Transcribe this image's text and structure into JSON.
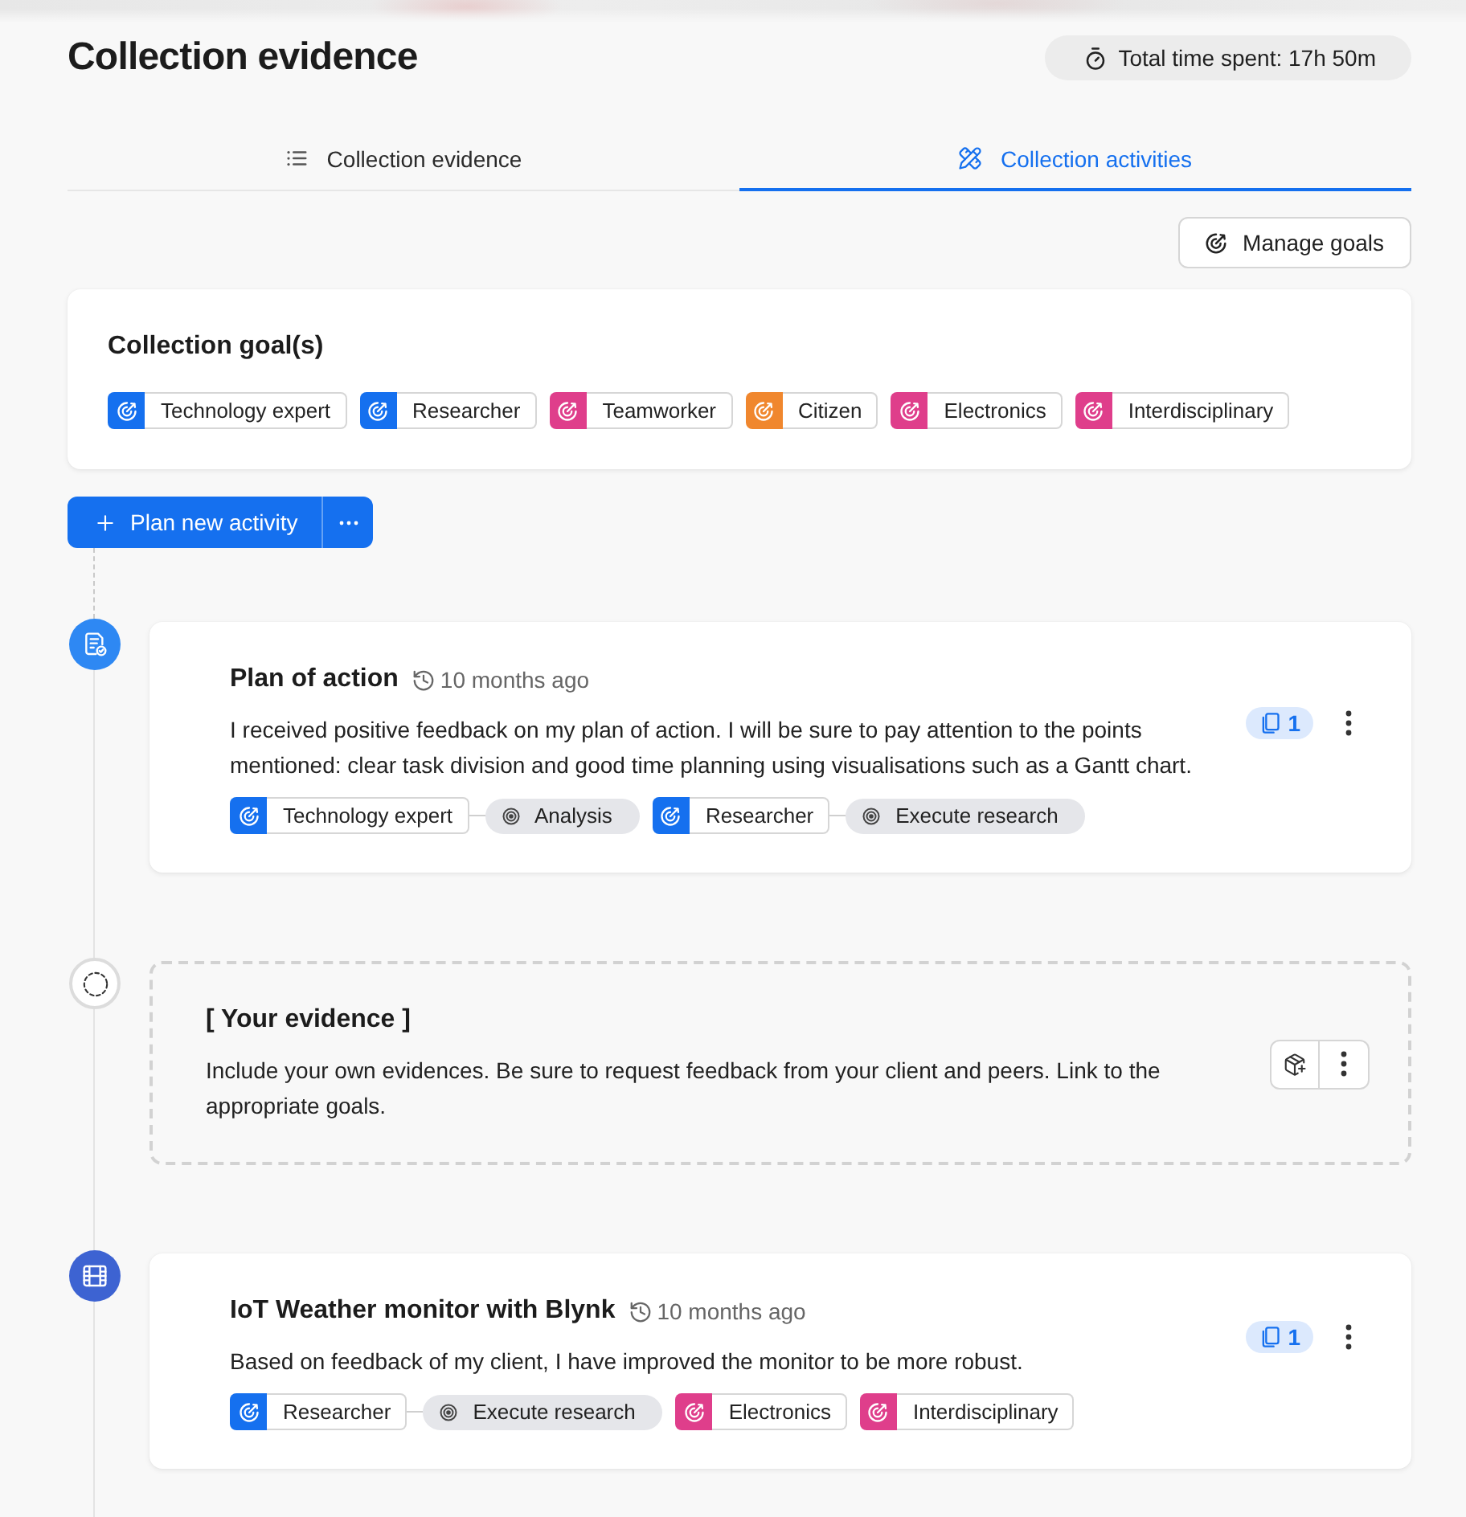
{
  "header": {
    "title": "Collection evidence",
    "time_spent": "Total time spent: 17h 50m"
  },
  "tabs": [
    {
      "label": "Collection evidence",
      "selected": false
    },
    {
      "label": "Collection activities",
      "selected": true
    }
  ],
  "manage_goals_button": "Manage goals",
  "goals_card": {
    "title": "Collection goal(s)",
    "goals": [
      {
        "label": "Technology expert",
        "color": "#1570ef"
      },
      {
        "label": "Researcher",
        "color": "#1570ef"
      },
      {
        "label": "Teamworker",
        "color": "#df3e8b"
      },
      {
        "label": "Citizen",
        "color": "#f0872e"
      },
      {
        "label": "Electronics",
        "color": "#df3e8b"
      },
      {
        "label": "Interdisciplinary",
        "color": "#df3e8b"
      }
    ]
  },
  "plan_button": "Plan new activity",
  "timeline": [
    {
      "kind": "document",
      "title": "Plan of action",
      "time": "10 months ago",
      "description": "I received positive feedback on my plan of action. I will be sure to pay attention to the points mentioned: clear task division and good time planning using visualisations such as a Gantt chart.",
      "attachments": "1",
      "goals": [
        {
          "label": "Technology expert",
          "color": "#1570ef",
          "skill": "Analysis"
        },
        {
          "label": "Researcher",
          "color": "#1570ef",
          "skill": "Execute research"
        }
      ]
    },
    {
      "kind": "placeholder",
      "title": "[ Your evidence ]",
      "description": "Include your own evidences. Be sure to request feedback from your client and peers. Link to the appropriate goals."
    },
    {
      "kind": "media",
      "title": "IoT Weather monitor with Blynk",
      "time": "10 months ago",
      "description": "Based on feedback of my client, I have improved the monitor to be more robust.",
      "attachments": "1",
      "goals": [
        {
          "label": "Researcher",
          "color": "#1570ef",
          "skill": "Execute research"
        },
        {
          "label": "Electronics",
          "color": "#df3e8b"
        },
        {
          "label": "Interdisciplinary",
          "color": "#df3e8b"
        }
      ]
    }
  ]
}
